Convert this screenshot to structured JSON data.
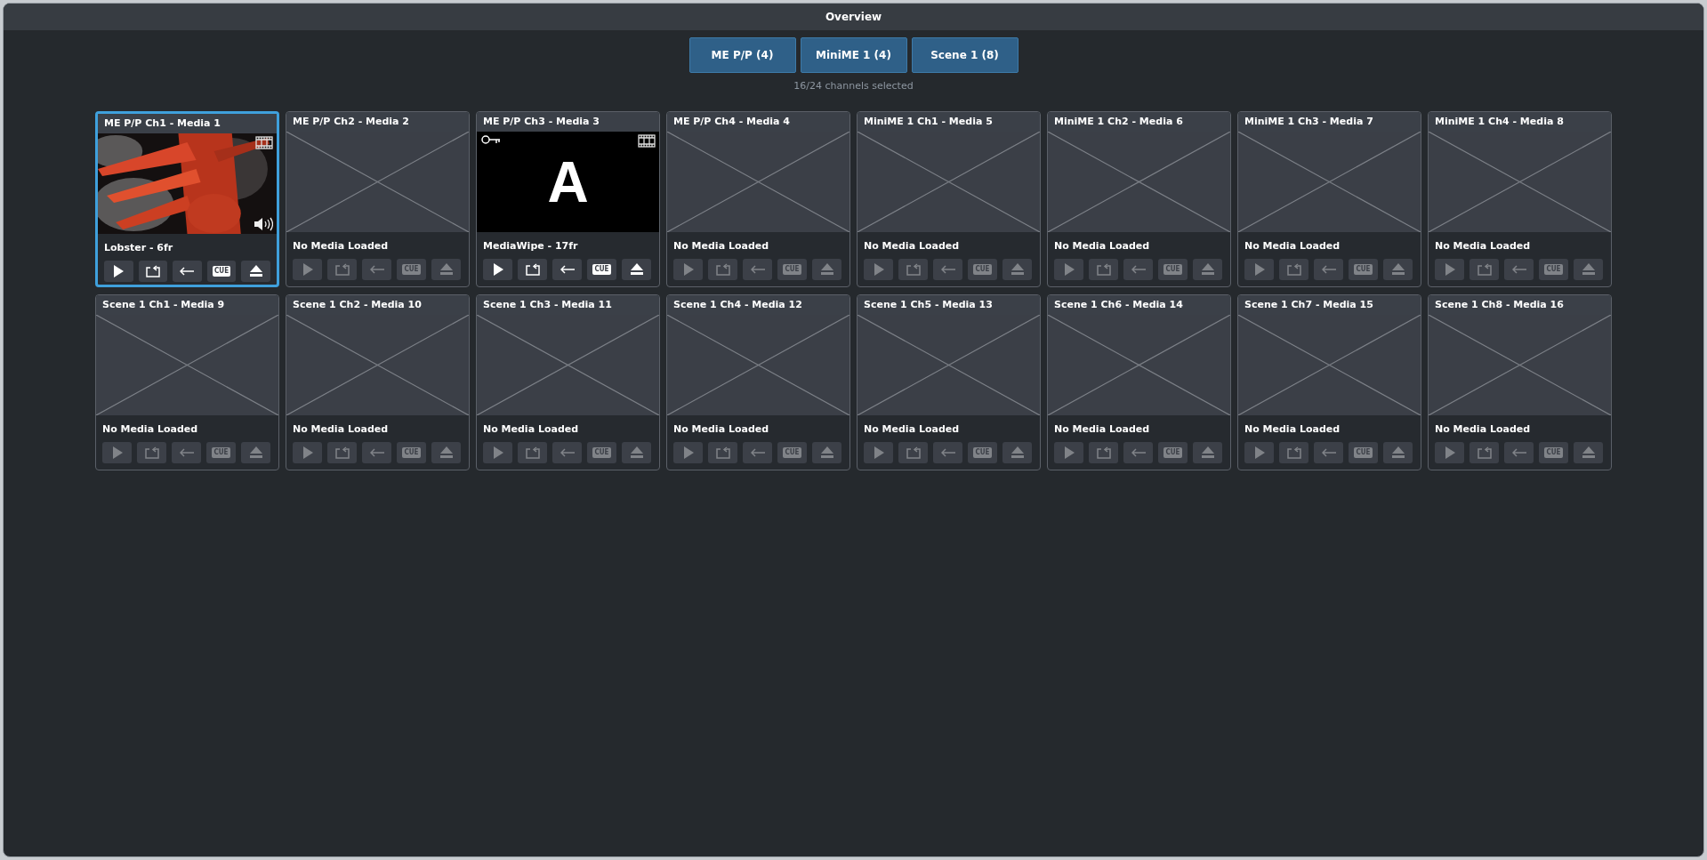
{
  "window": {
    "title": "Overview"
  },
  "tabs": [
    {
      "label": "ME P/P (4)",
      "selected": true
    },
    {
      "label": "MiniME 1 (4)",
      "selected": true
    },
    {
      "label": "Scene 1 (8)",
      "selected": true
    }
  ],
  "selection_summary": "16/24 channels selected",
  "channels": [
    {
      "title": "ME P/P Ch1 - Media 1",
      "selected": true,
      "preview": {
        "kind": "picture",
        "film": true,
        "audio": true
      },
      "media": "Lobster - 6fr",
      "enabled": true,
      "cue": "CUE"
    },
    {
      "title": "ME P/P Ch2 - Media 2",
      "selected": false,
      "preview": {
        "kind": "empty"
      },
      "media": "No Media Loaded",
      "enabled": false,
      "cue": "CUE"
    },
    {
      "title": "ME P/P Ch3 - Media 3",
      "selected": false,
      "preview": {
        "kind": "graphic",
        "letter": "A",
        "film": true,
        "key": true
      },
      "media": "MediaWipe - 17fr",
      "enabled": true,
      "cue": "CUE"
    },
    {
      "title": "ME P/P Ch4 - Media 4",
      "selected": false,
      "preview": {
        "kind": "empty"
      },
      "media": "No Media Loaded",
      "enabled": false,
      "cue": "CUE"
    },
    {
      "title": "MiniME 1 Ch1 - Media 5",
      "selected": false,
      "preview": {
        "kind": "empty"
      },
      "media": "No Media Loaded",
      "enabled": false,
      "cue": "CUE"
    },
    {
      "title": "MiniME 1 Ch2 - Media 6",
      "selected": false,
      "preview": {
        "kind": "empty"
      },
      "media": "No Media Loaded",
      "enabled": false,
      "cue": "CUE"
    },
    {
      "title": "MiniME 1 Ch3 - Media 7",
      "selected": false,
      "preview": {
        "kind": "empty"
      },
      "media": "No Media Loaded",
      "enabled": false,
      "cue": "CUE"
    },
    {
      "title": "MiniME 1 Ch4 - Media 8",
      "selected": false,
      "preview": {
        "kind": "empty"
      },
      "media": "No Media Loaded",
      "enabled": false,
      "cue": "CUE"
    },
    {
      "title": "Scene 1 Ch1 - Media 9",
      "selected": false,
      "preview": {
        "kind": "empty"
      },
      "media": "No Media Loaded",
      "enabled": false,
      "cue": "CUE"
    },
    {
      "title": "Scene 1 Ch2 - Media 10",
      "selected": false,
      "preview": {
        "kind": "empty"
      },
      "media": "No Media Loaded",
      "enabled": false,
      "cue": "CUE"
    },
    {
      "title": "Scene 1 Ch3 - Media 11",
      "selected": false,
      "preview": {
        "kind": "empty"
      },
      "media": "No Media Loaded",
      "enabled": false,
      "cue": "CUE"
    },
    {
      "title": "Scene 1 Ch4 - Media 12",
      "selected": false,
      "preview": {
        "kind": "empty"
      },
      "media": "No Media Loaded",
      "enabled": false,
      "cue": "CUE"
    },
    {
      "title": "Scene 1 Ch5 - Media 13",
      "selected": false,
      "preview": {
        "kind": "empty"
      },
      "media": "No Media Loaded",
      "enabled": false,
      "cue": "CUE"
    },
    {
      "title": "Scene 1 Ch6 - Media 14",
      "selected": false,
      "preview": {
        "kind": "empty"
      },
      "media": "No Media Loaded",
      "enabled": false,
      "cue": "CUE"
    },
    {
      "title": "Scene 1 Ch7 - Media 15",
      "selected": false,
      "preview": {
        "kind": "empty"
      },
      "media": "No Media Loaded",
      "enabled": false,
      "cue": "CUE"
    },
    {
      "title": "Scene 1 Ch8 - Media 16",
      "selected": false,
      "preview": {
        "kind": "empty"
      },
      "media": "No Media Loaded",
      "enabled": false,
      "cue": "CUE"
    }
  ]
}
